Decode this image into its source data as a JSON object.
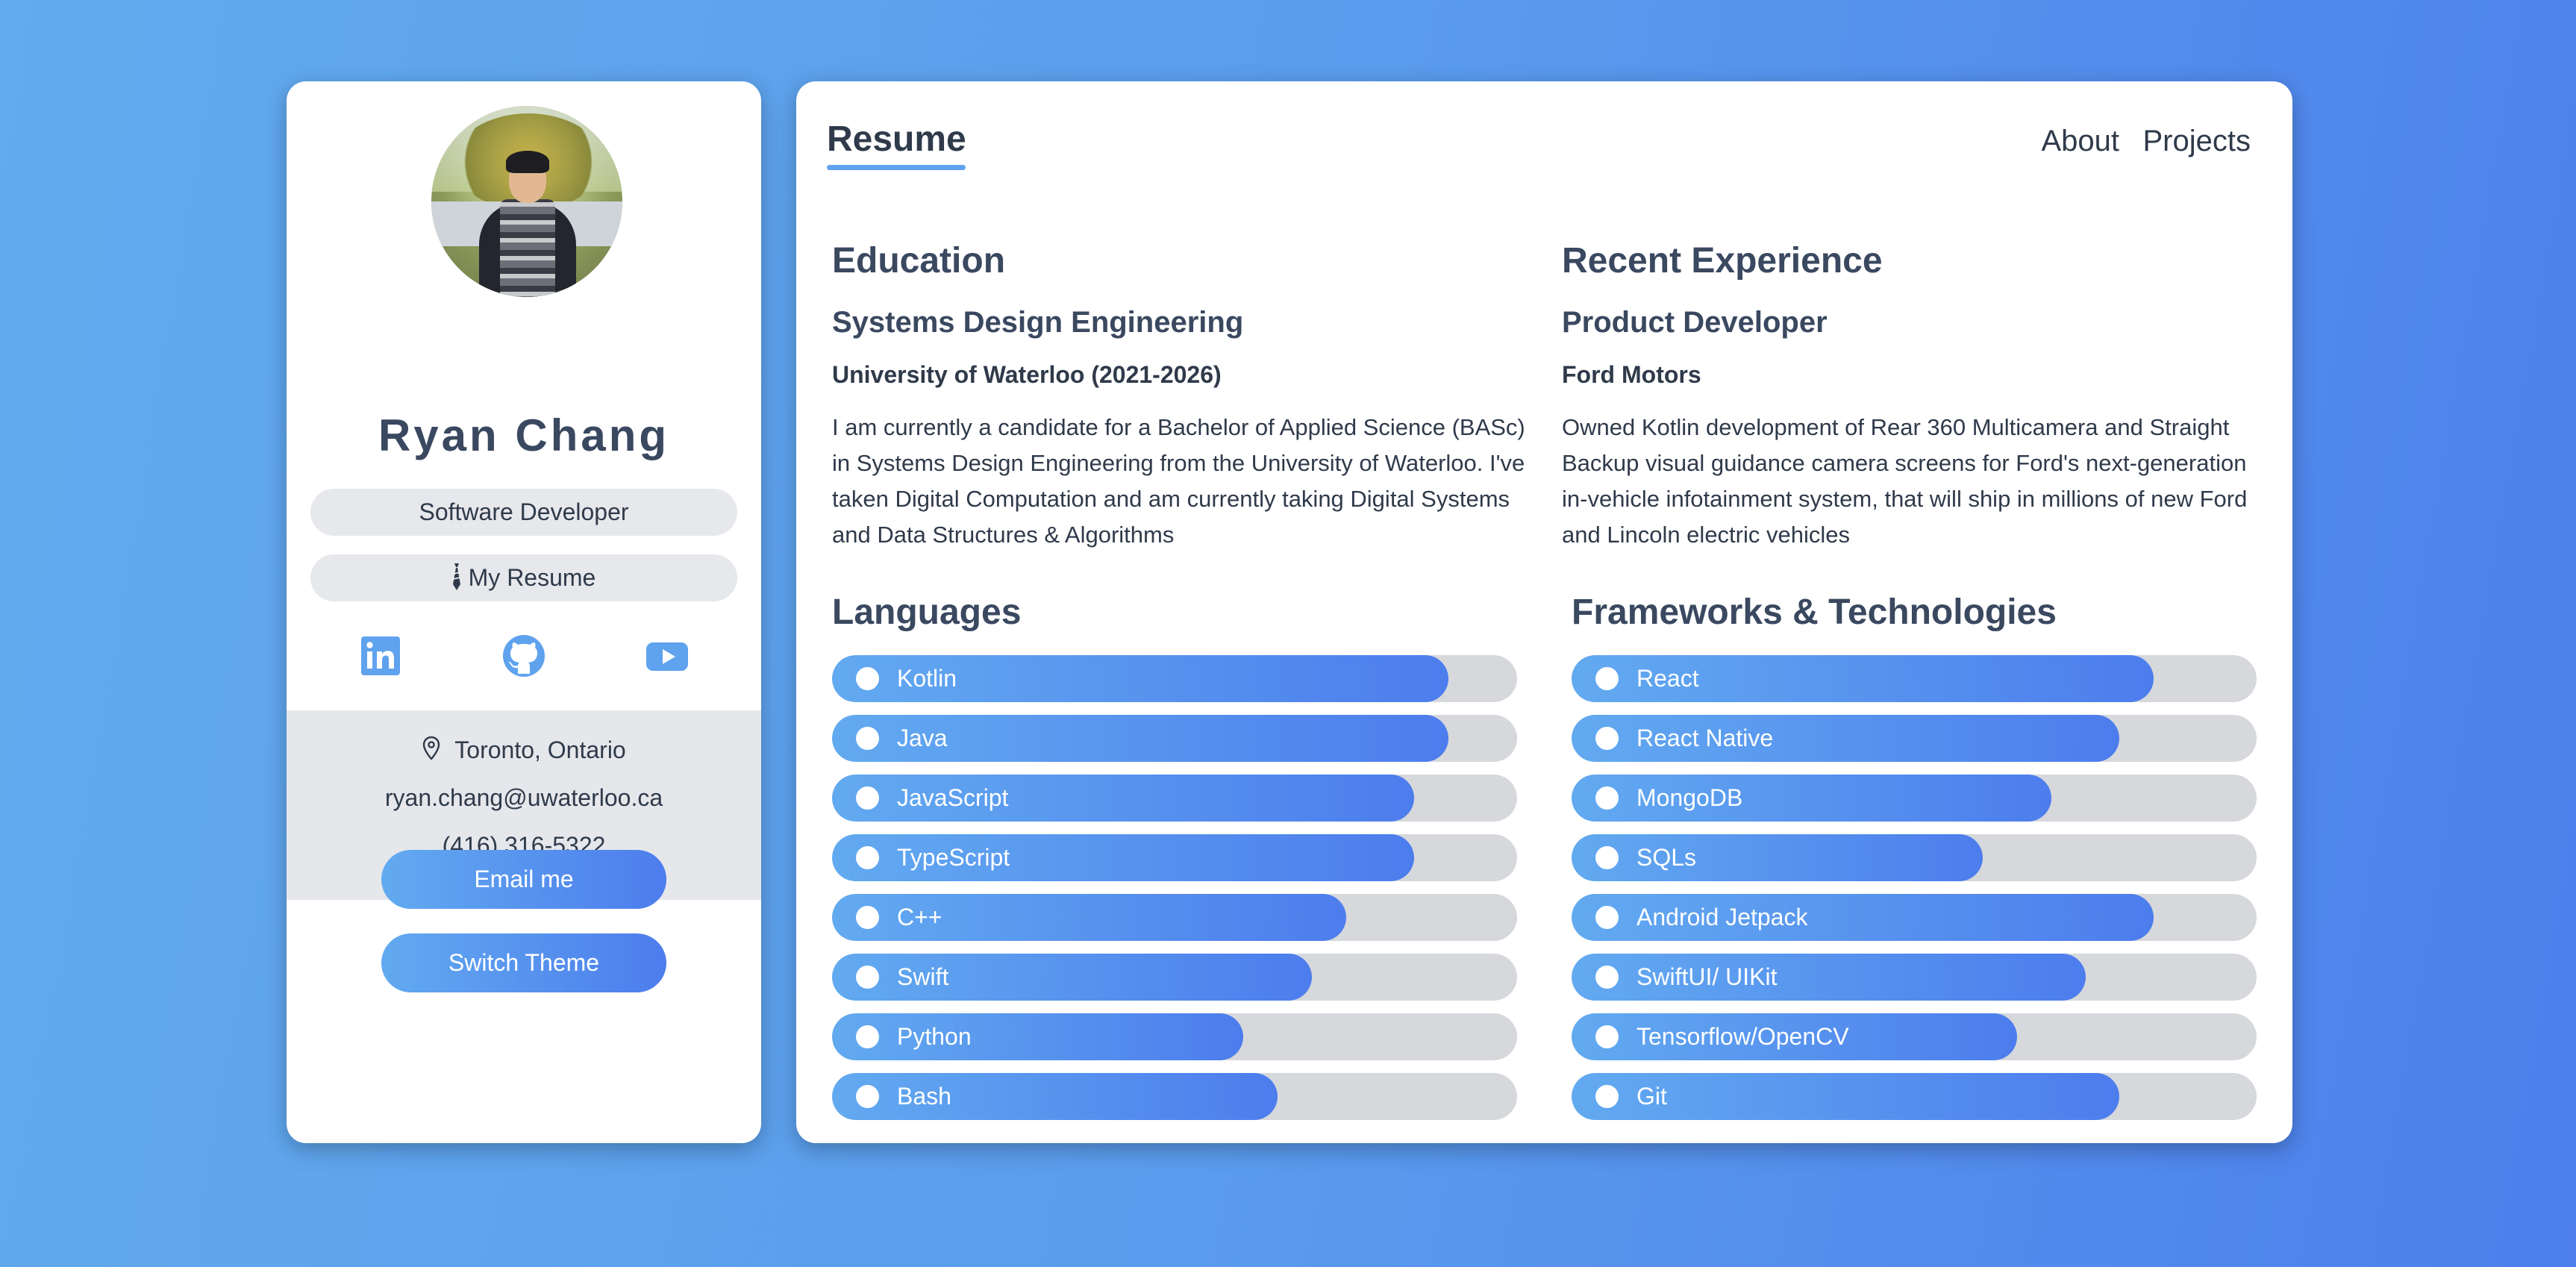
{
  "profile": {
    "name": "Ryan Chang",
    "role": "Software Developer",
    "resume_label": "My Resume",
    "socials": [
      {
        "name": "linkedin",
        "icon": "linkedin-icon"
      },
      {
        "name": "github",
        "icon": "github-icon"
      },
      {
        "name": "youtube",
        "icon": "youtube-icon"
      }
    ],
    "location": "Toronto, Ontario",
    "email": "ryan.chang@uwaterloo.ca",
    "phone": "(416) 316-5322",
    "email_button": "Email me",
    "theme_button": "Switch Theme"
  },
  "header": {
    "active_tab": "Resume",
    "nav": [
      "About",
      "Projects"
    ]
  },
  "education": {
    "title": "Education",
    "program": "Systems Design Engineering",
    "school": "University of Waterloo (2021-2026)",
    "description": "I am currently a candidate for a Bachelor of Applied Science (BASc) in Systems Design Engineering from the University of Waterloo. I've taken Digital Computation and am currently taking Digital Systems and Data Structures & Algorithms"
  },
  "experience": {
    "title": "Recent Experience",
    "position": "Product Developer",
    "company": "Ford Motors",
    "description": "Owned Kotlin development of Rear 360 Multicamera and Straight Backup visual guidance camera screens for Ford's next-generation in-vehicle infotainment system, that will ship in millions of new Ford and Lincoln electric vehicles"
  },
  "languages": {
    "title": "Languages",
    "items": [
      {
        "label": "Kotlin",
        "level": 0.9
      },
      {
        "label": "Java",
        "level": 0.9
      },
      {
        "label": "JavaScript",
        "level": 0.85
      },
      {
        "label": "TypeScript",
        "level": 0.85
      },
      {
        "label": "C++",
        "level": 0.75
      },
      {
        "label": "Swift",
        "level": 0.7
      },
      {
        "label": "Python",
        "level": 0.6
      },
      {
        "label": "Bash",
        "level": 0.65
      }
    ]
  },
  "frameworks": {
    "title": "Frameworks & Technologies",
    "items": [
      {
        "label": "React",
        "level": 0.85
      },
      {
        "label": "React Native",
        "level": 0.8
      },
      {
        "label": "MongoDB",
        "level": 0.7
      },
      {
        "label": "SQLs",
        "level": 0.6
      },
      {
        "label": "Android Jetpack",
        "level": 0.85
      },
      {
        "label": "SwiftUI/ UIKit",
        "level": 0.75
      },
      {
        "label": "Tensorflow/OpenCV",
        "level": 0.65
      },
      {
        "label": "Git",
        "level": 0.8
      }
    ]
  },
  "colors": {
    "accent_start": "#62aaf0",
    "accent_end": "#4d7ded",
    "track": "#d6d8dc",
    "text": "#2f3a4a"
  }
}
